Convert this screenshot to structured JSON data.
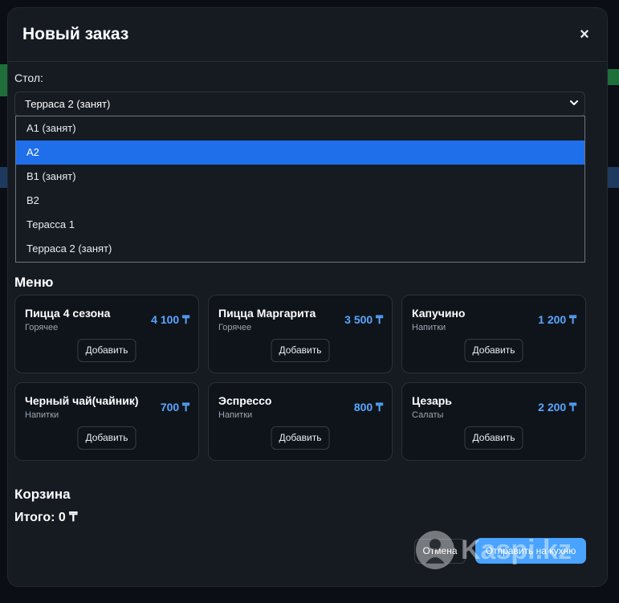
{
  "modal": {
    "title": "Новый заказ",
    "close_icon": "×"
  },
  "table_select": {
    "label": "Стол:",
    "value": "Терраса 2 (занят)",
    "options": [
      "A1 (занят)",
      "A2",
      "B1 (занят)",
      "B2",
      "Терасса 1",
      "Терраса 2 (занят)"
    ],
    "highlighted": "A2"
  },
  "menu": {
    "title": "Меню",
    "add_label": "Добавить",
    "items": [
      {
        "name": "Пицца 4 сезона",
        "category": "Горячее",
        "price": "4 100 ₸"
      },
      {
        "name": "Пицца Маргарита",
        "category": "Горячее",
        "price": "3 500 ₸"
      },
      {
        "name": "Капучино",
        "category": "Напитки",
        "price": "1 200 ₸"
      },
      {
        "name": "Черный чай(чайник)",
        "category": "Напитки",
        "price": "700 ₸"
      },
      {
        "name": "Эспрессо",
        "category": "Напитки",
        "price": "800 ₸"
      },
      {
        "name": "Цезарь",
        "category": "Салаты",
        "price": "2 200 ₸"
      }
    ]
  },
  "cart": {
    "title": "Корзина",
    "total": "Итого: 0 ₸"
  },
  "actions": {
    "cancel": "Отмена",
    "send": "Отправить на кухню"
  },
  "watermark": "Kaspi.kz",
  "colors": {
    "accent": "#4aa3ff",
    "price": "#58a6ff",
    "highlight": "#1f6feb",
    "modal_bg": "#161b22"
  }
}
